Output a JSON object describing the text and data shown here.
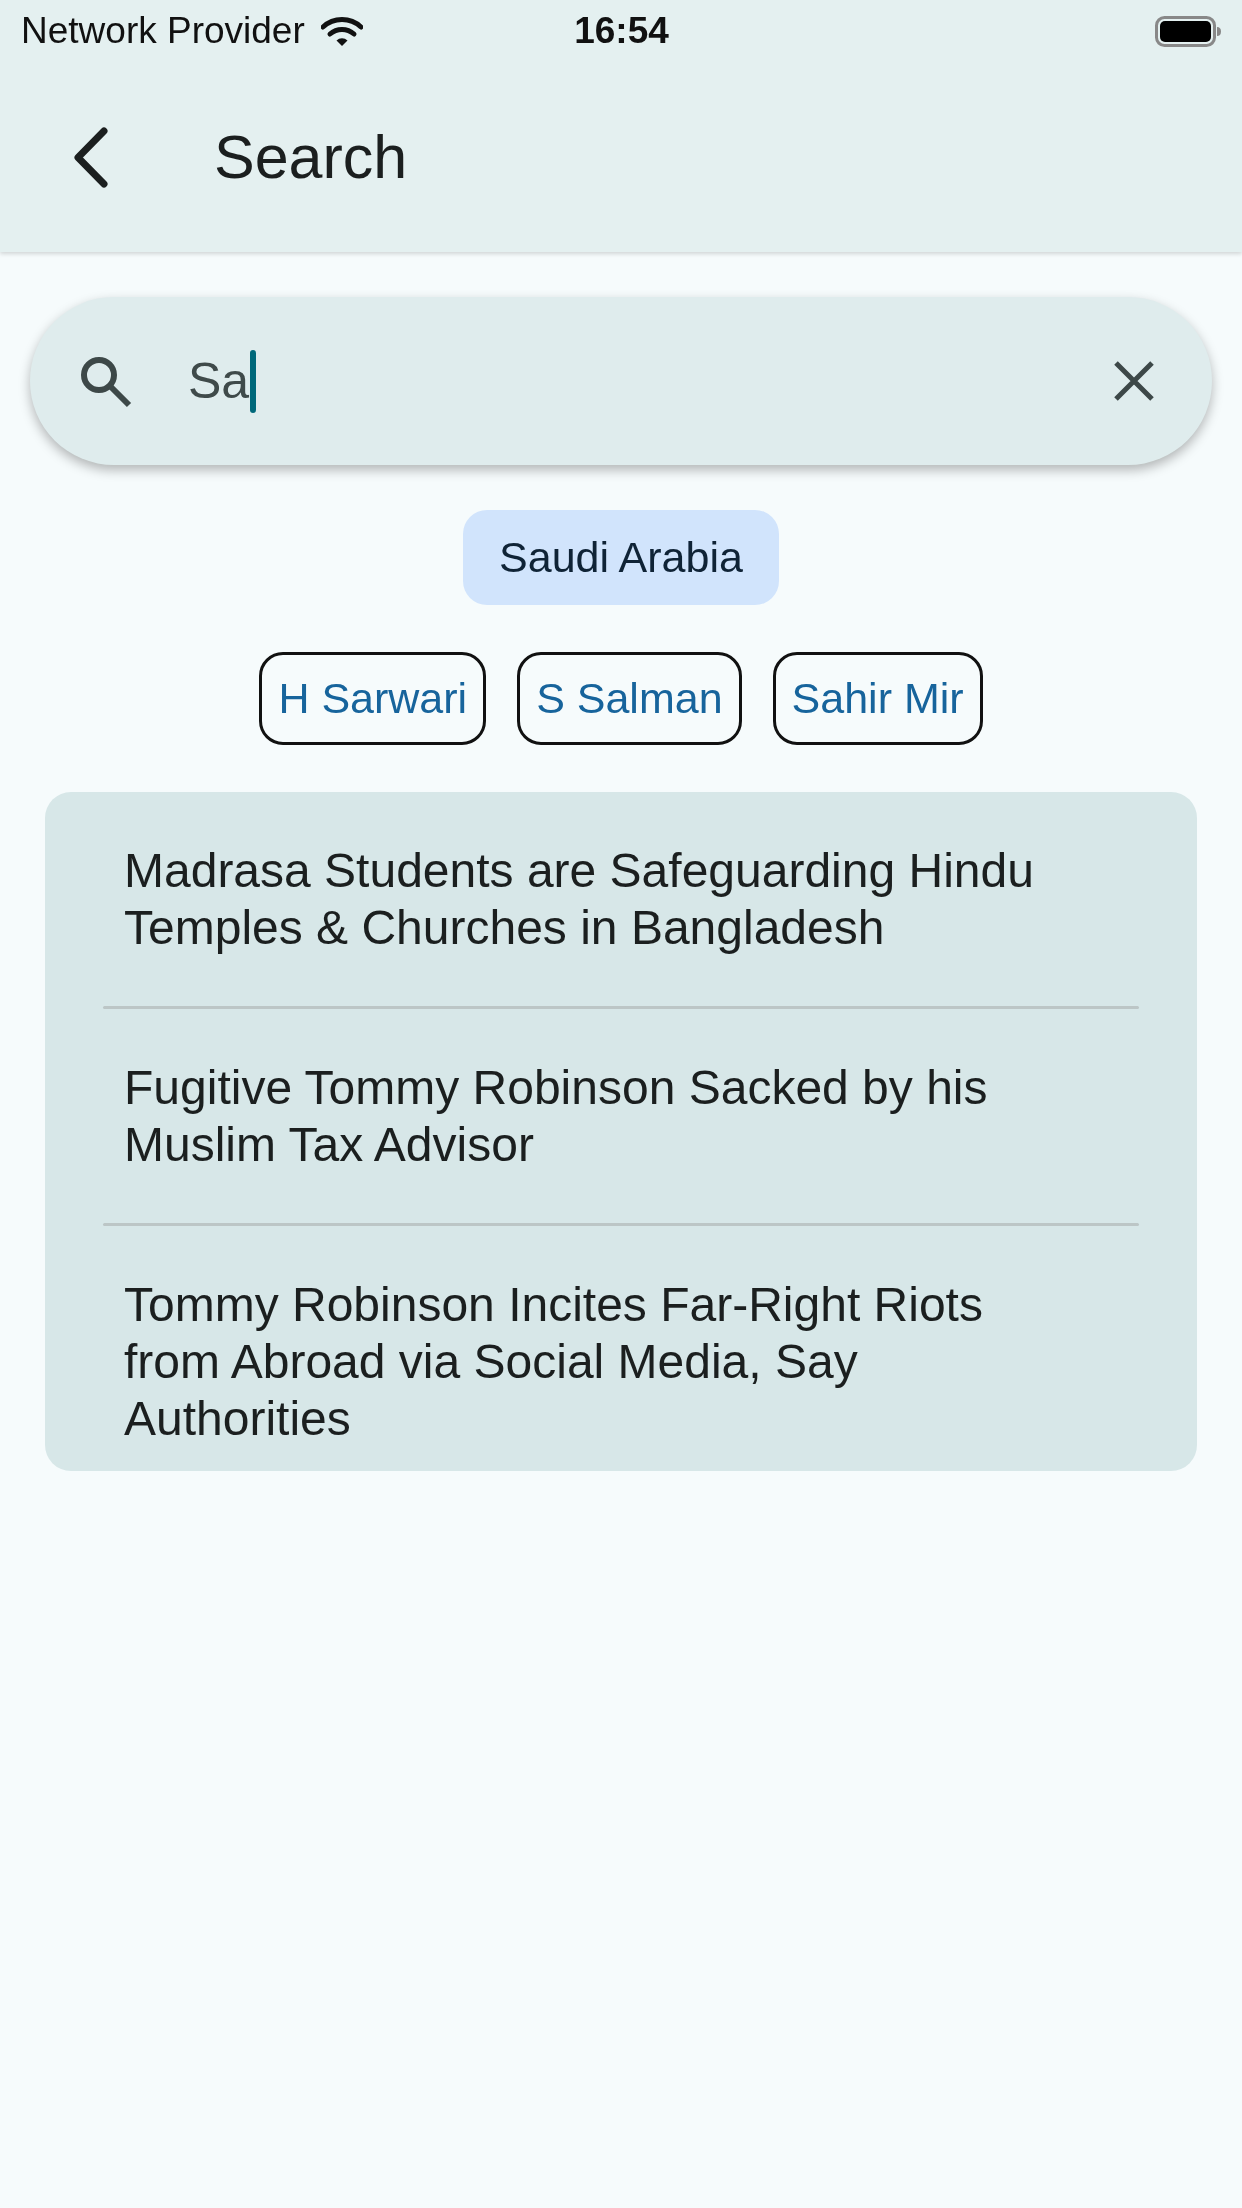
{
  "status_bar": {
    "carrier": "Network Provider",
    "time": "16:54"
  },
  "header": {
    "title": "Search"
  },
  "search": {
    "value": "Sa",
    "focused": true
  },
  "highlighted_chip": {
    "label": "Saudi Arabia"
  },
  "chips": [
    {
      "label": "H Sarwari"
    },
    {
      "label": "S Salman"
    },
    {
      "label": "Sahir Mir"
    }
  ],
  "results": [
    {
      "title": "Madrasa Students are Safeguarding Hindu Temples & Churches in Bangladesh"
    },
    {
      "title": "Fugitive Tommy Robinson Sacked by his Muslim Tax Advisor"
    },
    {
      "title": "Tommy Robinson Incites Far-Right Riots from Abroad via Social Media, Say Authorities"
    }
  ]
}
